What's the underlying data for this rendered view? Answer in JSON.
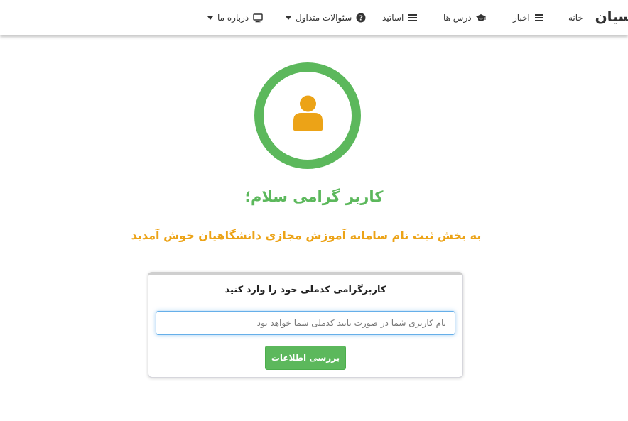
{
  "navbar": {
    "brand": "سیان",
    "items": [
      {
        "label": "خانه",
        "icon": "none"
      },
      {
        "label": "اخبار",
        "icon": "list-icon"
      },
      {
        "label": "درس ها",
        "icon": "graduation-cap-icon"
      },
      {
        "label": "اساتید",
        "icon": "list-icon"
      },
      {
        "label": "سئوالات متداول",
        "icon": "question-circle-icon",
        "dropdown": true
      },
      {
        "label": "درباره ما",
        "icon": "desktop-icon",
        "dropdown": true
      }
    ]
  },
  "hero": {
    "avatar_icon": "user-icon",
    "ring_color": "#5cb85c",
    "icon_color": "#eca317",
    "greeting": "کاربر گرامی سلام؛",
    "welcome": "به بخش ثبت نام سامانه آموزش مجازی دانشگاهیان خوش آمدید"
  },
  "form": {
    "title": "کاربرگرامی کدملی خود را وارد کنید",
    "national_id": {
      "value": "",
      "placeholder": "نام کاربری شما در صورت تایید کدملی شما خواهد بود"
    },
    "submit_label": "بررسی اطلاعات"
  },
  "colors": {
    "accent_green": "#5cb85c",
    "accent_orange": "#eca317"
  }
}
